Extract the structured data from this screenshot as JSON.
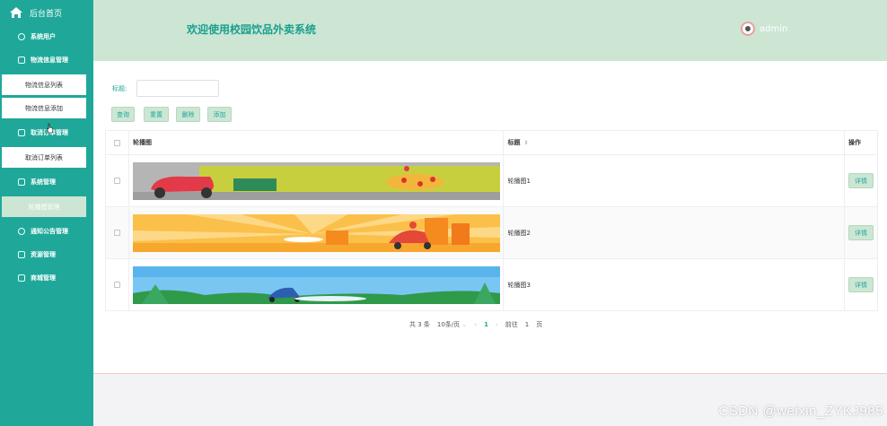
{
  "sidebar": {
    "home_label": "后台首页",
    "menu": [
      {
        "label": "系统用户",
        "icon": "chat-icon"
      },
      {
        "label": "物流信息管理",
        "icon": "edit-icon"
      },
      {
        "label": "物流信息列表",
        "sub": true
      },
      {
        "label": "物流信息添加",
        "sub": true
      },
      {
        "label": "取消订单管理",
        "icon": "receipt-icon"
      },
      {
        "label": "取消订单列表",
        "sub": true
      },
      {
        "label": "系统管理",
        "icon": "edit-icon"
      },
      {
        "label": "轮播图管理",
        "sub": true,
        "active": true
      },
      {
        "label": "通知公告管理",
        "icon": "chat-icon"
      },
      {
        "label": "资源管理",
        "icon": "receipt-icon"
      },
      {
        "label": "商城管理",
        "icon": "square-icon"
      }
    ]
  },
  "header": {
    "title": "欢迎使用校园饮品外卖系统",
    "username": "admin"
  },
  "search": {
    "label": "标题:",
    "value": ""
  },
  "toolbar": {
    "query": "查询",
    "reset": "重置",
    "delete": "删除",
    "add": "添加"
  },
  "table": {
    "headers": {
      "image": "轮播图",
      "title": "标题",
      "sort_icon": "⇕",
      "action": "操作"
    },
    "rows": [
      {
        "title": "轮播图1",
        "action": "详情",
        "image": "delivery-scooter-pizza-banner"
      },
      {
        "title": "轮播图2",
        "action": "详情",
        "image": "delivery-rider-sunburst-banner"
      },
      {
        "title": "轮播图3",
        "action": "详情",
        "image": "delivery-rider-park-banner"
      }
    ]
  },
  "pager": {
    "total": "共 3 条",
    "page_size": "10条/页",
    "current": "1",
    "goto_label": "前往",
    "goto_value": "1",
    "page_suffix": "页"
  },
  "watermark": "CSDN @weixin_ZYKJ985",
  "colors": {
    "sidebar": "#1fa89a",
    "header": "#cde6d4",
    "accent": "#1fa89a"
  }
}
